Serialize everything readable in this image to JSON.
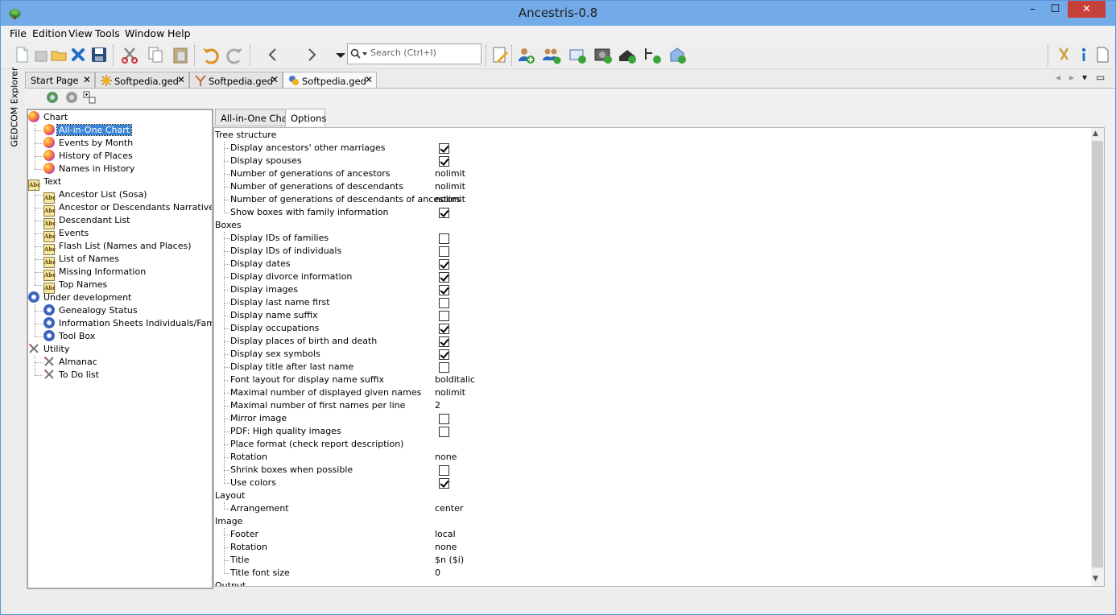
{
  "window": {
    "title": "Ancestris-0.8",
    "min": "–",
    "max": "☐",
    "close": "✕"
  },
  "menu": [
    "File",
    "Edition",
    "View",
    "Tools",
    "Window",
    "Help"
  ],
  "toolbar": {
    "search_placeholder": "Search (Ctrl+I)"
  },
  "sidebar": {
    "label": "GEDCOM Explorer"
  },
  "doc_tabs": [
    {
      "label": "Start Page",
      "close": "✕"
    },
    {
      "label": "Softpedia.ged",
      "close": "✕"
    },
    {
      "label": "Softpedia.ged",
      "close": "✕"
    },
    {
      "label": "Softpedia.ged",
      "close": "✕"
    }
  ],
  "tree": {
    "groups": [
      {
        "label": "Chart",
        "icon": "chart-icon",
        "items": [
          "All-in-One Chart",
          "Events by Month",
          "History of Places",
          "Names in History"
        ]
      },
      {
        "label": "Text",
        "icon": "text-report-icon",
        "items": [
          "Ancestor List (Sosa)",
          "Ancestor or Descendants Narrative",
          "Descendant List",
          "Events",
          "Flash List (Names and Places)",
          "List of Names",
          "Missing Information",
          "Top Names"
        ]
      },
      {
        "label": "Under development",
        "icon": "gear-icon",
        "items": [
          "Genealogy Status",
          "Information Sheets Individuals/Families",
          "Tool Box"
        ]
      },
      {
        "label": "Utility",
        "icon": "tools-icon",
        "items": [
          "Almanac",
          "To Do list"
        ]
      }
    ],
    "selected": "All-in-One Chart",
    "icon_text": "Abc"
  },
  "sub_tabs": [
    "All-in-One Chart",
    "Options"
  ],
  "options": [
    {
      "type": "group",
      "label": "Tree structure"
    },
    {
      "label": "Display ancestors' other marriages",
      "checkbox": true,
      "checked": true
    },
    {
      "label": "Display spouses",
      "checkbox": true,
      "checked": true
    },
    {
      "label": "Number of generations of ancestors",
      "value": "nolimit"
    },
    {
      "label": "Number of generations of descendants",
      "value": "nolimit"
    },
    {
      "label": "Number of generations of descendants of ancestors",
      "value": "nolimit"
    },
    {
      "label": "Show boxes with family information",
      "checkbox": true,
      "checked": true
    },
    {
      "type": "group",
      "label": "Boxes"
    },
    {
      "label": "Display IDs of families",
      "checkbox": true,
      "checked": false
    },
    {
      "label": "Display IDs of individuals",
      "checkbox": true,
      "checked": false
    },
    {
      "label": "Display dates",
      "checkbox": true,
      "checked": true
    },
    {
      "label": "Display divorce information",
      "checkbox": true,
      "checked": true
    },
    {
      "label": "Display images",
      "checkbox": true,
      "checked": true
    },
    {
      "label": "Display last name first",
      "checkbox": true,
      "checked": false
    },
    {
      "label": "Display name suffix",
      "checkbox": true,
      "checked": false
    },
    {
      "label": "Display occupations",
      "checkbox": true,
      "checked": true
    },
    {
      "label": "Display places of birth and death",
      "checkbox": true,
      "checked": true
    },
    {
      "label": "Display sex symbols",
      "checkbox": true,
      "checked": true
    },
    {
      "label": "Display title after last name",
      "checkbox": true,
      "checked": false
    },
    {
      "label": "Font layout for display name suffix",
      "value": "bolditalic"
    },
    {
      "label": "Maximal number of displayed given names",
      "value": "nolimit"
    },
    {
      "label": "Maximal number of first names per line",
      "value": "2"
    },
    {
      "label": "Mirror image",
      "checkbox": true,
      "checked": false
    },
    {
      "label": "PDF: High quality images",
      "checkbox": true,
      "checked": false
    },
    {
      "label": "Place format (check report description)",
      "value": ""
    },
    {
      "label": "Rotation",
      "value": "none"
    },
    {
      "label": "Shrink boxes when possible",
      "checkbox": true,
      "checked": false
    },
    {
      "label": "Use colors",
      "checkbox": true,
      "checked": true
    },
    {
      "type": "group",
      "label": "Layout"
    },
    {
      "label": "Arrangement",
      "value": "center"
    },
    {
      "type": "group",
      "label": "Image"
    },
    {
      "label": "Footer",
      "value": "local"
    },
    {
      "label": "Rotation",
      "value": "none"
    },
    {
      "label": "Title",
      "value": "$n ($i)"
    },
    {
      "label": "Title font size",
      "value": "0"
    },
    {
      "type": "group",
      "label": "Output"
    }
  ]
}
